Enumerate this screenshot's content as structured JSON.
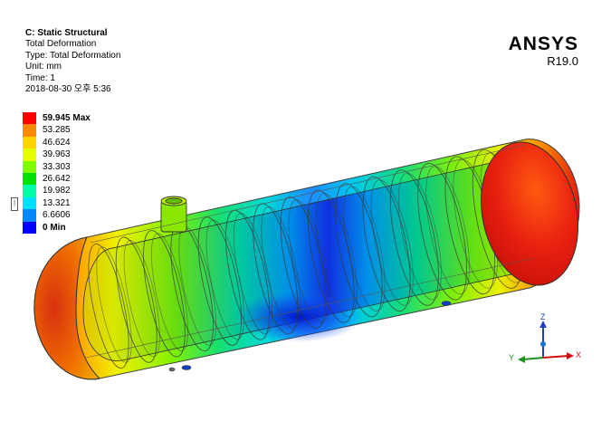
{
  "info": {
    "title": "C: Static Structural",
    "result": "Total Deformation",
    "type": "Type: Total Deformation",
    "unit": "Unit: mm",
    "time": "Time: 1",
    "timestamp": "2018-08-30 오후 5:36"
  },
  "logo": {
    "brand": "ANSYS",
    "version": "R19.0"
  },
  "legend": [
    {
      "label": "59.945 Max",
      "color": "#ff0000",
      "bold": true
    },
    {
      "label": "53.285",
      "color": "#ff8a00",
      "bold": false
    },
    {
      "label": "46.624",
      "color": "#ffd500",
      "bold": false
    },
    {
      "label": "39.963",
      "color": "#e3ff00",
      "bold": false
    },
    {
      "label": "33.303",
      "color": "#7fff00",
      "bold": false
    },
    {
      "label": "26.642",
      "color": "#00e100",
      "bold": false
    },
    {
      "label": "19.982",
      "color": "#00ffa8",
      "bold": false
    },
    {
      "label": "13.321",
      "color": "#00e1ff",
      "bold": false
    },
    {
      "label": "6.6606",
      "color": "#0086ff",
      "bold": false
    },
    {
      "label": "0 Min",
      "color": "#0000ff",
      "bold": true
    }
  ],
  "triad": {
    "z_label": "Z",
    "y_label": "Y",
    "x_label": "X",
    "z_color": "#1f3fbf",
    "y_color": "#1f8f1f",
    "x_color": "#d01010"
  }
}
